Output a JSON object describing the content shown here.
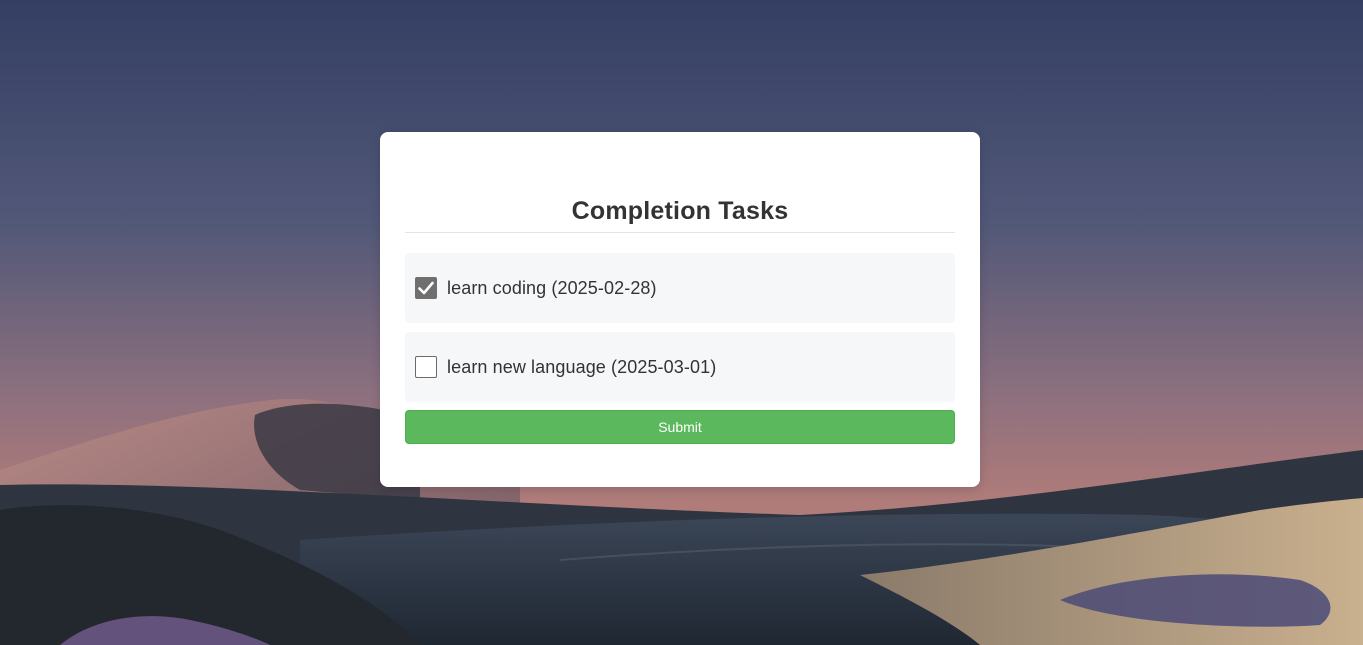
{
  "page": {
    "title": "Completion Tasks",
    "submit_label": "Submit"
  },
  "tasks": [
    {
      "label": "learn coding (2025-02-28)",
      "checked": true
    },
    {
      "label": "learn new language (2025-03-01)",
      "checked": false
    }
  ],
  "colors": {
    "submit_button": "#5cb85c",
    "card_background": "#ffffff",
    "task_background": "#f6f7f9",
    "checked_box": "#6f6f6f"
  }
}
